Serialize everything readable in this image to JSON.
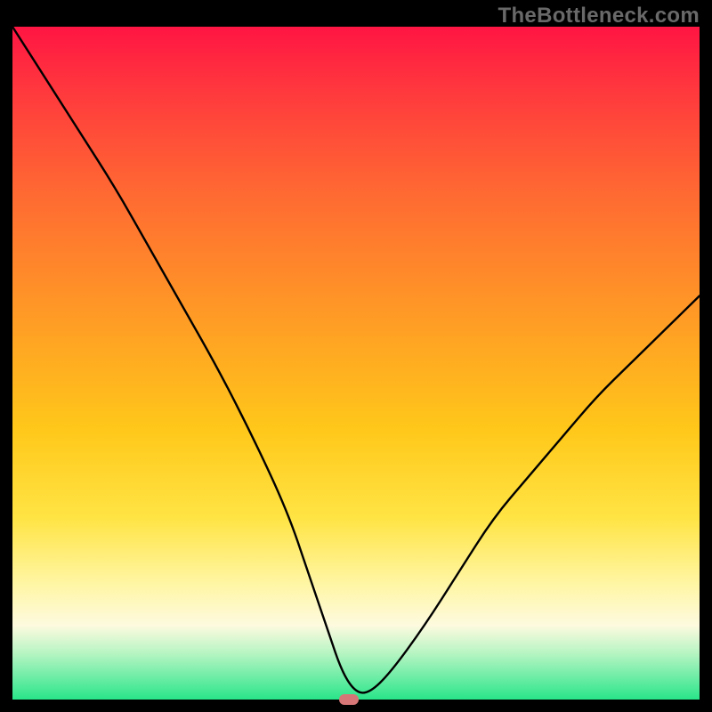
{
  "watermark": "TheBottleneck.com",
  "colors": {
    "frame_bg": "#000000",
    "gradient_top": "#ff1543",
    "gradient_mid1": "#ff6a32",
    "gradient_mid2": "#ffc81a",
    "gradient_mid3": "#fff6a6",
    "gradient_bottom": "#29e58a",
    "curve": "#000000",
    "marker": "#d77676",
    "watermark_text": "#696969"
  },
  "chart_data": {
    "type": "line",
    "title": "",
    "xlabel": "",
    "ylabel": "",
    "xlim": [
      0,
      100
    ],
    "ylim": [
      0,
      100
    ],
    "series": [
      {
        "name": "bottleneck-curve",
        "x": [
          0,
          5,
          10,
          15,
          20,
          25,
          30,
          35,
          40,
          43,
          46,
          48,
          50,
          52,
          55,
          60,
          65,
          70,
          75,
          80,
          85,
          90,
          95,
          100
        ],
        "values": [
          100,
          92,
          84,
          76,
          67,
          58,
          49,
          39,
          28,
          19,
          10,
          4,
          1,
          1,
          4,
          11,
          19,
          27,
          33,
          39,
          45,
          50,
          55,
          60
        ]
      }
    ],
    "marker": {
      "x": 49,
      "y": 0
    },
    "annotations": []
  }
}
